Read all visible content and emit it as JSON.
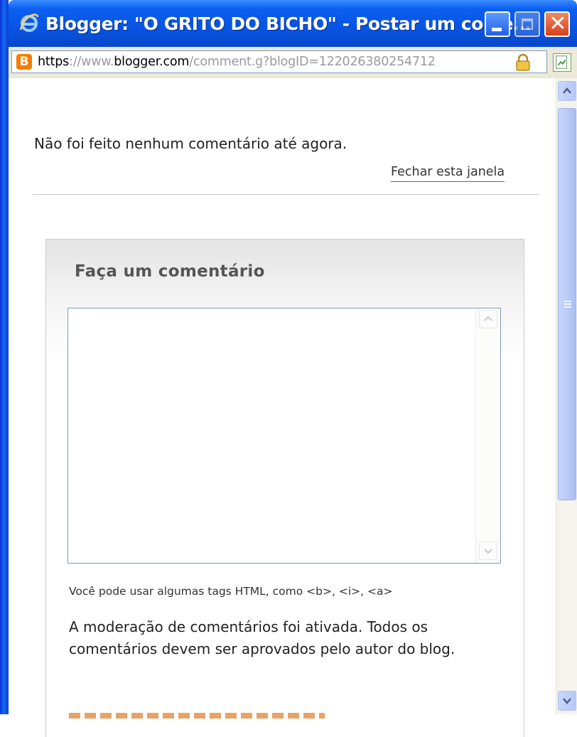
{
  "window": {
    "title": "Blogger: \"O GRITO DO BICHO\" - Postar um come…",
    "close_glyph": "✕"
  },
  "address_bar": {
    "scheme": "https",
    "sep": "://",
    "www": "www.",
    "domain": "blogger.com",
    "path": "/comment.g?blogID=122026380254712",
    "site_icon_glyph": "B"
  },
  "page": {
    "no_comments_text": "Não foi feito nenhum comentário até agora.",
    "close_window_link": "Fechar esta janela",
    "comment_form": {
      "heading": "Faça um comentário",
      "textarea_value": "",
      "html_hint": "Você pode usar algumas tags HTML, como <b>, <i>, <a>",
      "moderation_notice": "A moderação de comentários foi ativada. Todos os comentários devem ser aprovados pelo autor do blog."
    }
  },
  "colors": {
    "titlebar": "#0854e3",
    "link_accent": "#e07b22",
    "blogger_orange": "#f57d00"
  },
  "icons": [
    "ie-icon",
    "minimize-icon",
    "maximize-icon",
    "close-icon",
    "blogger-icon",
    "lock-icon",
    "rss-icon",
    "scroll-up-icon",
    "scroll-down-icon"
  ]
}
